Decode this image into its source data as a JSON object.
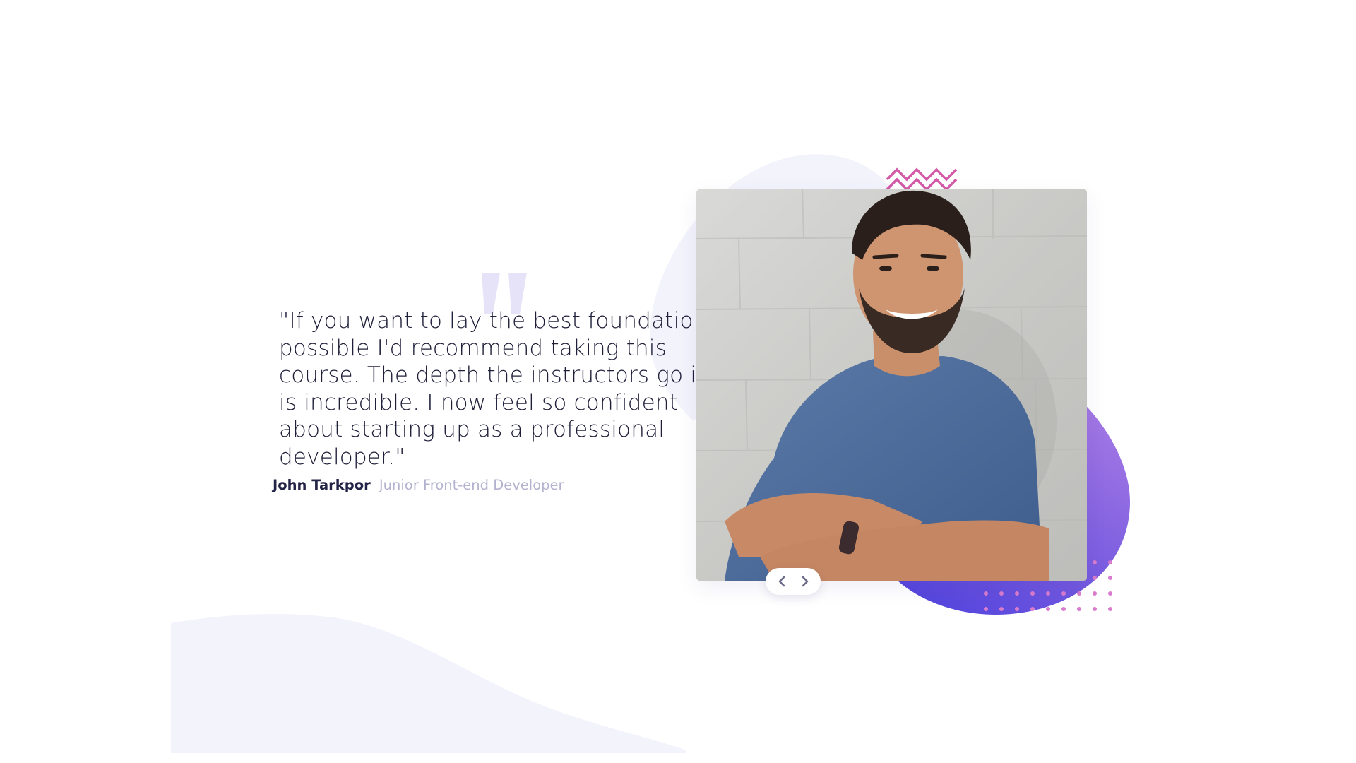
{
  "testimonial": {
    "quote": "\"If you want to lay the best foundation possible I'd recommend taking this course. The depth the instructors go into is incredible. I now feel so confident about starting up as a professional developer.\"",
    "author_name": "John Tarkpor",
    "author_role": "Junior Front-end Developer"
  },
  "navigation": {
    "prev_icon": "chevron-left-icon",
    "next_icon": "chevron-right-icon"
  },
  "colors": {
    "quote_text": "#1f1f3a",
    "author_name": "#232346",
    "author_role": "#b4b3cf",
    "quote_mark": "#e6e3f8",
    "background_shape": "#f3f3fc",
    "blob_gradient_start": "#4b3fdc",
    "blob_gradient_end": "#9b6fe0",
    "zigzag": "#d45aa8",
    "dots": "#d97ccd"
  },
  "icons": {
    "quote": "quote-icon",
    "zigzag": "zigzag-decoration",
    "dots": "dot-pattern-decoration"
  }
}
